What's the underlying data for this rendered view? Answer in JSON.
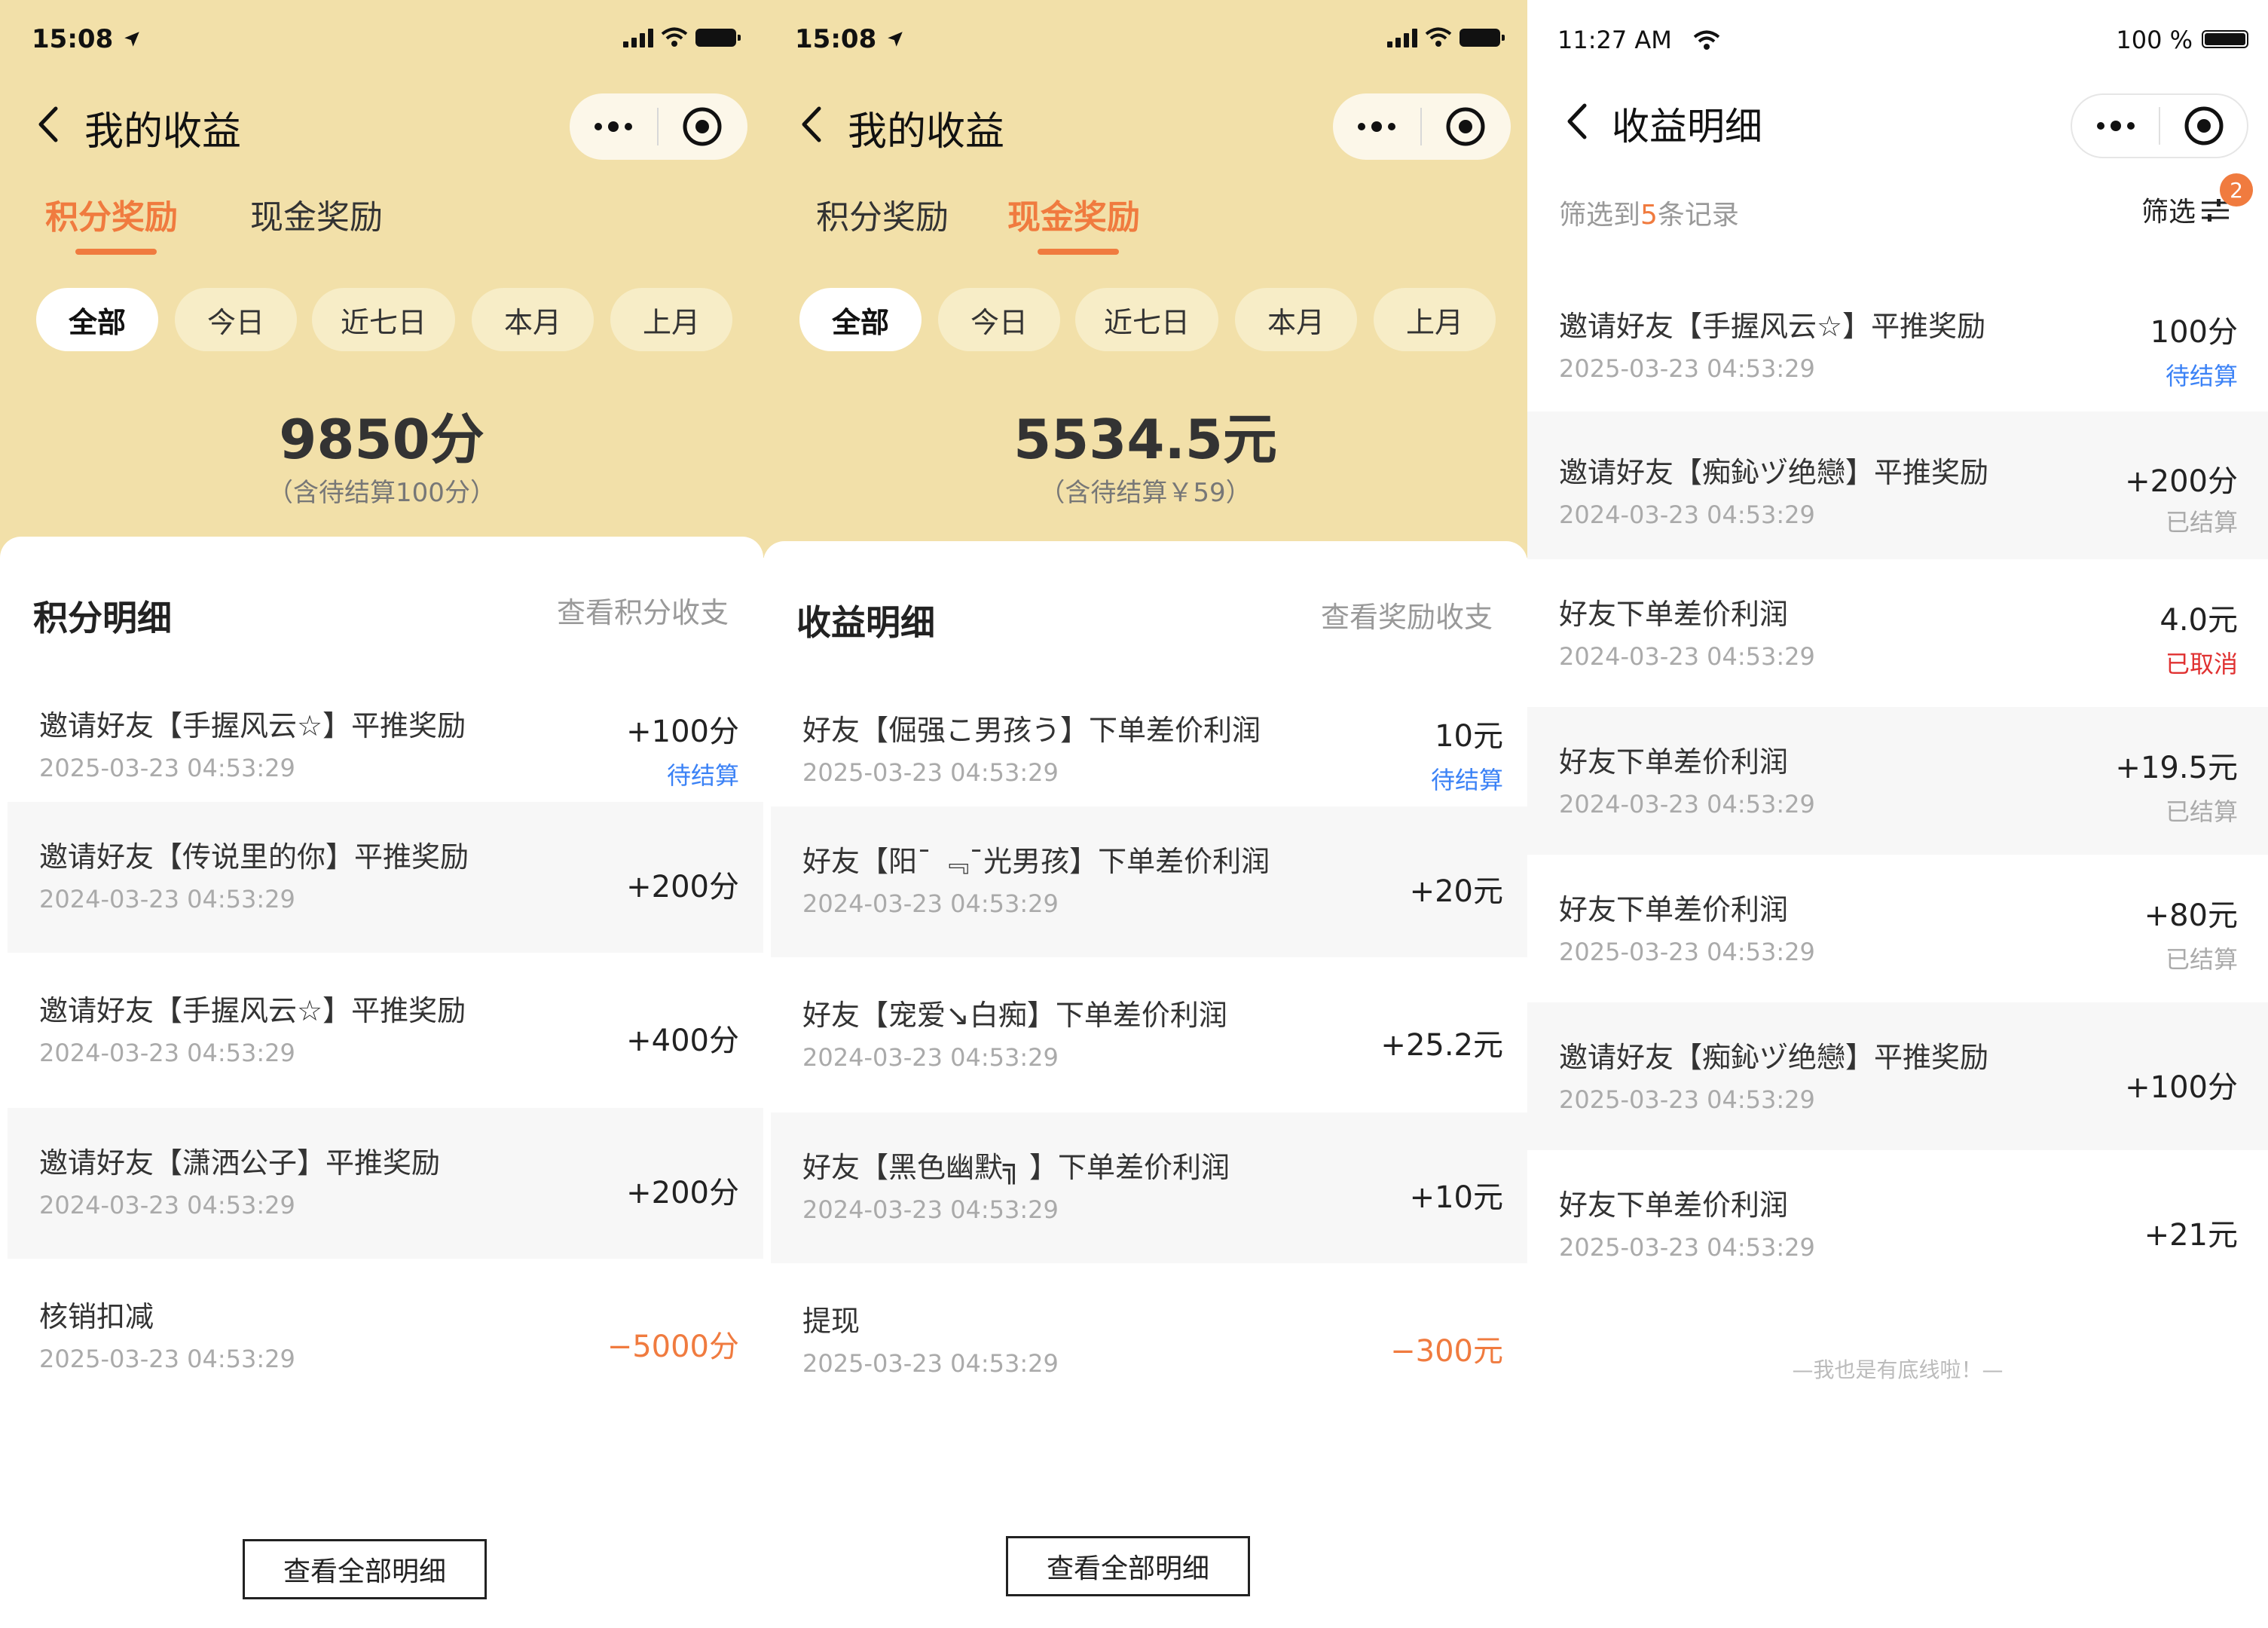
{
  "screens": {
    "points": {
      "status_time": "15:08",
      "nav_title": "我的收益",
      "tabs": [
        "积分奖励",
        "现金奖励"
      ],
      "filters": [
        "全部",
        "今日",
        "近七日",
        "本月",
        "上月"
      ],
      "total": "9850分",
      "total_sub": "（含待结算100分）",
      "section_title": "积分明细",
      "section_link": "查看积分收支",
      "records": [
        {
          "title": "邀请好友【手握风云☆】平推奖励",
          "time": "2025-03-23  04:53:29",
          "amount": "+100分",
          "status": "待结算"
        },
        {
          "title": "邀请好友【传说里的你】平推奖励",
          "time": "2024-03-23  04:53:29",
          "amount": "+200分",
          "status": ""
        },
        {
          "title": "邀请好友【手握风云☆】平推奖励",
          "time": "2024-03-23  04:53:29",
          "amount": "+400分",
          "status": ""
        },
        {
          "title": "邀请好友【潇洒公子】平推奖励",
          "time": "2024-03-23  04:53:29",
          "amount": "+200分",
          "status": ""
        },
        {
          "title": "核销扣减",
          "time": "2025-03-23  04:53:29",
          "amount": "−5000分",
          "status": ""
        }
      ],
      "view_all": "查看全部明细"
    },
    "cash": {
      "status_time": "15:08",
      "nav_title": "我的收益",
      "tabs": [
        "积分奖励",
        "现金奖励"
      ],
      "filters": [
        "全部",
        "今日",
        "近七日",
        "本月",
        "上月"
      ],
      "total": "5534.5元",
      "total_sub": "（含待结算￥59）",
      "section_title": "收益明细",
      "section_link": "查看奖励收支",
      "records": [
        {
          "title": "好友【倔强こ男孩う】下单差价利润",
          "time": "2025-03-23  04:53:29",
          "amount": "10元",
          "status": "待结算"
        },
        {
          "title": "好友【阳¯ ﹃¯光男孩】下单差价利润",
          "time": "2024-03-23  04:53:29",
          "amount": "+20元",
          "status": ""
        },
        {
          "title": "好友【宠爱↘白痴】下单差价利润",
          "time": "2024-03-23  04:53:29",
          "amount": "+25.2元",
          "status": ""
        },
        {
          "title": "好友【黑色幽默╗ 】下单差价利润",
          "time": "2024-03-23  04:53:29",
          "amount": "+10元",
          "status": ""
        },
        {
          "title": "提现",
          "time": "2025-03-23  04:53:29",
          "amount": "−300元",
          "status": ""
        }
      ],
      "view_all": "查看全部明细"
    },
    "detail": {
      "status_time": "11:27 AM",
      "battery_text": "100 %",
      "nav_title": "收益明细",
      "filter_prefix": "筛选到",
      "filter_count": "5",
      "filter_suffix": "条记录",
      "filter_label": "筛选",
      "filter_badge": "2",
      "records": [
        {
          "title": "邀请好友【手握风云☆】平推奖励",
          "time": "2025-03-23  04:53:29",
          "amount": "100分",
          "status": "待结算"
        },
        {
          "title": "邀请好友【痴鈊ヅ绝戀】平推奖励",
          "time": "2024-03-23  04:53:29",
          "amount": "+200分",
          "status": "已结算"
        },
        {
          "title": "好友下单差价利润",
          "time": "2024-03-23  04:53:29",
          "amount": "4.0元",
          "status": "已取消"
        },
        {
          "title": "好友下单差价利润",
          "time": "2024-03-23  04:53:29",
          "amount": "+19.5元",
          "status": "已结算"
        },
        {
          "title": "好友下单差价利润",
          "time": "2025-03-23  04:53:29",
          "amount": "+80元",
          "status": "已结算"
        },
        {
          "title": "邀请好友【痴鈊ヅ绝戀】平推奖励",
          "time": "2025-03-23  04:53:29",
          "amount": "+100分",
          "status": ""
        },
        {
          "title": "好友下单差价利润",
          "time": "2025-03-23  04:53:29",
          "amount": "+21元",
          "status": ""
        }
      ],
      "footer_note": "—我也是有底线啦！—"
    }
  },
  "colors": {
    "header_bg": "#f2e0a9",
    "accent": "#f07b3f",
    "pending": "#3b82f6",
    "cancelled": "#e03131",
    "settled": "#aaaaaa"
  },
  "icons": [
    "location-arrow-icon",
    "signal-icon",
    "wifi-icon",
    "battery-icon",
    "back-chevron-icon",
    "more-dots-icon",
    "target-icon",
    "filter-sliders-icon"
  ]
}
